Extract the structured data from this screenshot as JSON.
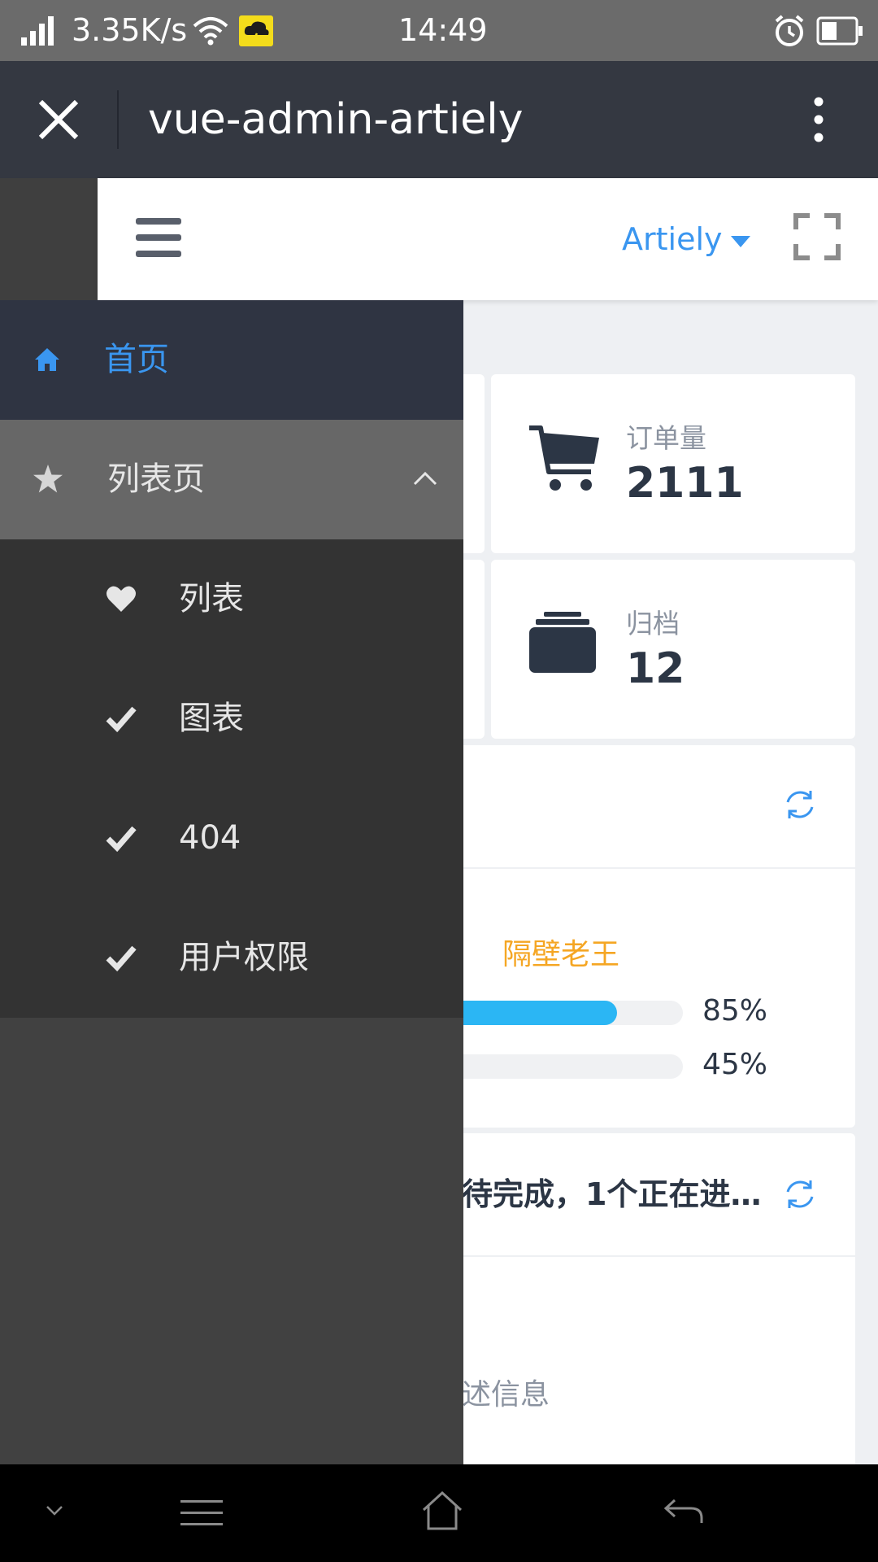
{
  "status_bar": {
    "speed": "3.35K/s",
    "time": "14:49"
  },
  "app_bar": {
    "title": "vue-admin-artiely"
  },
  "header": {
    "user_name": "Artiely"
  },
  "stats": {
    "orders": {
      "label": "订单量",
      "value": "2111",
      "icon": "cart-icon"
    },
    "archive": {
      "label": "归档",
      "value": "12",
      "icon": "folder-icon"
    }
  },
  "progress_card": {
    "name": "隔壁老王",
    "bars": [
      {
        "value": 0.85,
        "label": "85%"
      },
      {
        "value": 0.45,
        "label": "45%"
      }
    ]
  },
  "task_card": {
    "summary": "待完成，1个正在进…"
  },
  "desc_card": {
    "text": "述信息"
  },
  "sidebar": {
    "items": [
      {
        "label": "首页",
        "icon": "home-icon",
        "active": true
      },
      {
        "label": "列表页",
        "icon": "star-icon",
        "expanded": true
      },
      {
        "label": "列表",
        "icon": "heart-icon"
      },
      {
        "label": "图表",
        "icon": "check-icon"
      },
      {
        "label": "404",
        "icon": "check-icon"
      },
      {
        "label": "用户权限",
        "icon": "check-icon"
      }
    ]
  },
  "colors": {
    "accent": "#3a96f0",
    "sidebar_bg": "#414141",
    "sidebar_active_bg": "#2f3442",
    "sidebar_group_bg": "#676767",
    "sidebar_sub_bg": "#333333",
    "progress": "#2bb6f4",
    "name_orange": "#f5a623"
  }
}
